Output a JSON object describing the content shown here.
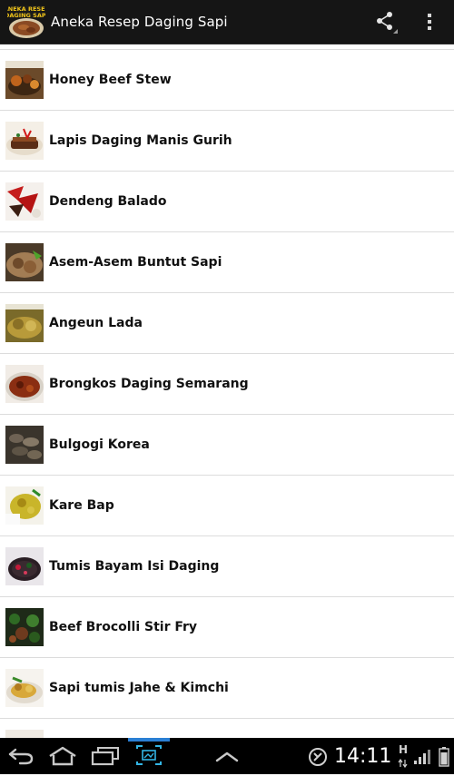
{
  "app": {
    "title": "Aneka Resep Daging Sapi",
    "icon_label_line1": "ANEKA RESEP",
    "icon_label_line2": "DAGING SAPI",
    "icon_name": "app-logo-icon",
    "actions": [
      {
        "name": "share",
        "icon": "share-icon"
      },
      {
        "name": "overflow",
        "icon": "overflow-menu-icon"
      }
    ]
  },
  "recipes": [
    {
      "label": "Honey Beef Stew"
    },
    {
      "label": "Lapis Daging Manis Gurih"
    },
    {
      "label": "Dendeng Balado"
    },
    {
      "label": "Asem-Asem Buntut Sapi"
    },
    {
      "label": "Angeun Lada"
    },
    {
      "label": "Brongkos Daging Semarang"
    },
    {
      "label": "Bulgogi Korea"
    },
    {
      "label": "Kare Bap"
    },
    {
      "label": "Tumis Bayam Isi Daging"
    },
    {
      "label": "Beef Brocolli Stir Fry"
    },
    {
      "label": "Sapi tumis Jahe & Kimchi"
    },
    {
      "label": ""
    }
  ],
  "system_bar": {
    "time": "14:11",
    "network_type": "H",
    "nav_icons": [
      "back-icon",
      "home-icon",
      "recent-apps-icon",
      "screenshot-icon",
      "menu-up-icon"
    ],
    "status_icons": [
      "location-sync-icon",
      "data-activity-icon",
      "signal-icon",
      "battery-icon"
    ]
  },
  "colors": {
    "actionbar_bg": "#151515",
    "list_bg": "#ffffff",
    "divider": "#dcdcdc",
    "text": "#111111",
    "sysbar_bg": "#000000"
  }
}
